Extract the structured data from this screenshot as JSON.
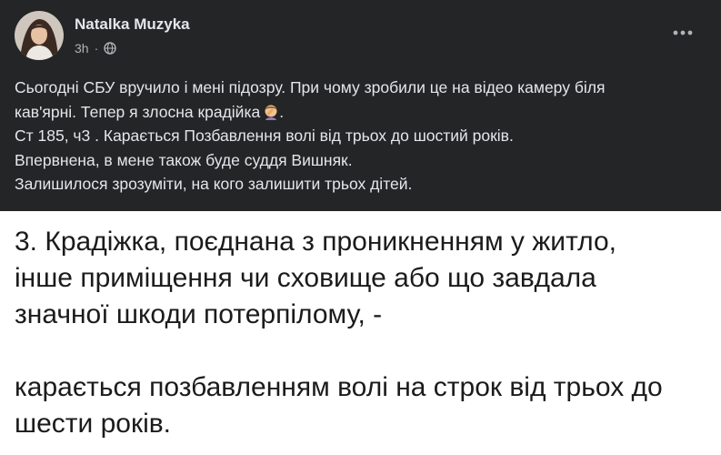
{
  "post": {
    "author": "Natalka Muzyka",
    "time": "3h",
    "audience_icon": "globe-icon",
    "menu_icon": "more-options-icon",
    "text_lines": [
      "Сьогодні СБУ вручило і мені підозру. При чому зробили це на відео камеру біля",
      "кав'ярні. Тепер я злосна крадійка",
      "Ст 185, ч3 . Карається  Позбавлення волі від трьох до шостий років.",
      "Впервнена, в мене також буде суддя Вишняк.",
      "Залишилося зрозуміти, на кого залишити трьох дітей."
    ],
    "emoji_after_line_2": "facepalm-emoji",
    "emoji_suffix": "."
  },
  "document": {
    "paragraph_1": [
      "3. Крадіжка, поєднана з проникненням у житло,",
      "інше приміщення чи сховище або що завдала",
      "значної шкоди потерпілому, -"
    ],
    "paragraph_2": [
      "карається позбавленням волі на строк від трьох до",
      "шести років."
    ]
  },
  "colors": {
    "post_background": "#242526",
    "post_text": "#e4e6eb",
    "secondary_text": "#b0b3b8",
    "document_background": "#ffffff",
    "document_text": "#1b1b1b"
  }
}
